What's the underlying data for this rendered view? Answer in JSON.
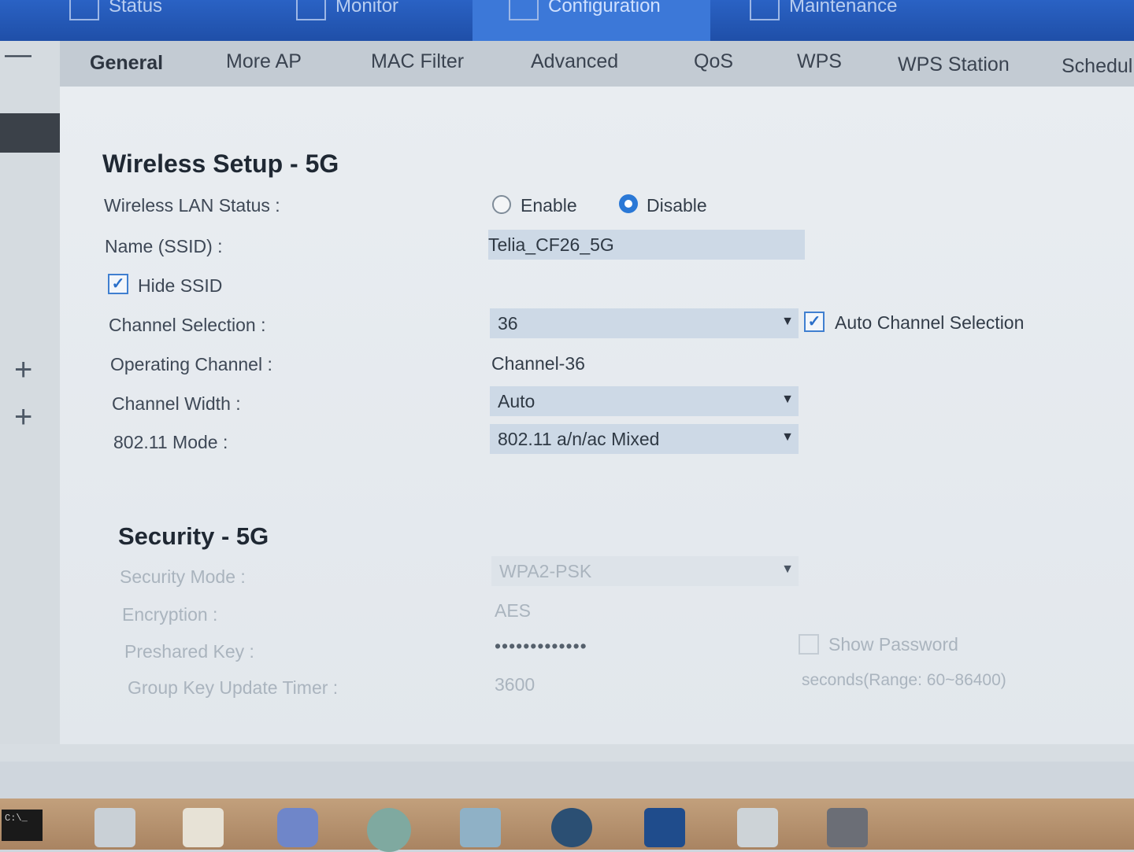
{
  "top_nav": {
    "tabs": [
      {
        "label": "Status",
        "icon": "status-icon"
      },
      {
        "label": "Monitor",
        "icon": "monitor-icon"
      },
      {
        "label": "Configuration",
        "icon": "configuration-icon"
      },
      {
        "label": "Maintenance",
        "icon": "maintenance-icon"
      }
    ],
    "active": "Configuration"
  },
  "sub_tabs": [
    "General",
    "More AP",
    "MAC Filter",
    "Advanced",
    "QoS",
    "WPS",
    "WPS Station",
    "Schedul"
  ],
  "active_sub_tab": "General",
  "wireless_setup": {
    "title": "Wireless Setup - 5G",
    "wlan_status_label": "Wireless LAN Status :",
    "enable_label": "Enable",
    "disable_label": "Disable",
    "wlan_status_value": "Disable",
    "ssid_label": "Name (SSID) :",
    "ssid_value": "Telia_CF26_5G",
    "hide_ssid_label": "Hide SSID",
    "hide_ssid_checked": true,
    "channel_selection_label": "Channel Selection :",
    "channel_selection_value": "36",
    "auto_channel_label": "Auto Channel Selection",
    "auto_channel_checked": true,
    "operating_channel_label": "Operating Channel :",
    "operating_channel_value": "Channel-36",
    "channel_width_label": "Channel Width :",
    "channel_width_value": "Auto",
    "mode_label": "802.11 Mode :",
    "mode_value": "802.11 a/n/ac Mixed"
  },
  "security": {
    "title": "Security - 5G",
    "security_mode_label": "Security Mode :",
    "security_mode_value": "WPA2-PSK",
    "encryption_label": "Encryption :",
    "encryption_value": "AES",
    "preshared_key_label": "Preshared Key :",
    "preshared_key_value": "•••••••••••••",
    "show_password_label": "Show Password",
    "group_key_label": "Group Key Update Timer :",
    "group_key_value": "3600",
    "group_key_hint": "seconds(Range: 60~86400)"
  },
  "taskbar": {
    "cmd_text": "C:\\_",
    "apps": [
      "notes-app-icon",
      "notepad-plus-plus-icon",
      "discord-icon",
      "browser-icon",
      "remote-desktop-icon",
      "steam-icon",
      "cheat-engine-icon",
      "monitor-app-icon",
      "archive-icon"
    ]
  },
  "colors": {
    "top_bar": "#2a62c4",
    "accent": "#2a78d6",
    "taskbar": "#b89371"
  }
}
